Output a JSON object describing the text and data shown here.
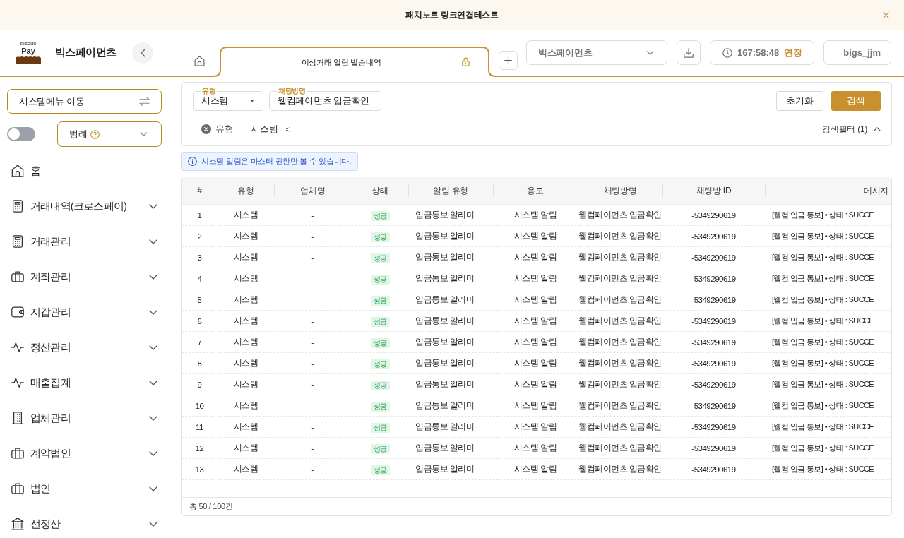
{
  "banner": {
    "text": "패치노트 링크연결테스트"
  },
  "sidebar": {
    "logo": {
      "tagline": "biscuit",
      "wordmark": "Pay"
    },
    "brand": "빅스페이먼츠",
    "menu_move": {
      "label": "시스템메뉴 이동"
    },
    "toggle": {
      "on": false
    },
    "legend": {
      "label": "범례"
    },
    "items": [
      {
        "label": "홈",
        "kind": "home",
        "expandable": false
      },
      {
        "label": "거래내역(크로스페이)",
        "kind": "calculator",
        "expandable": true,
        "expanded": false
      },
      {
        "label": "거래관리",
        "kind": "calculator",
        "expandable": true,
        "expanded": false
      },
      {
        "label": "계좌관리",
        "kind": "briefcase",
        "expandable": true,
        "expanded": false
      },
      {
        "label": "지갑관리",
        "kind": "wallet",
        "expandable": true,
        "expanded": false
      },
      {
        "label": "정산관리",
        "kind": "pulse",
        "expandable": true,
        "expanded": false
      },
      {
        "label": "매출집계",
        "kind": "pulse",
        "expandable": true,
        "expanded": false
      },
      {
        "label": "업체관리",
        "kind": "building",
        "expandable": true,
        "expanded": false
      },
      {
        "label": "계약법인",
        "kind": "briefcase",
        "expandable": true,
        "expanded": false
      },
      {
        "label": "법인",
        "kind": "briefcase",
        "expandable": true,
        "expanded": false
      },
      {
        "label": "선정산",
        "kind": "bank",
        "expandable": true,
        "expanded": false
      }
    ]
  },
  "tabs": [
    {
      "label": "이상거래 알림 발송내역",
      "selected": true,
      "locked": true
    }
  ],
  "header": {
    "company": "빅스페이먼츠",
    "timer": "167:58:48",
    "extend": "연장",
    "user": "bigs_jjm"
  },
  "filters": {
    "fields": [
      {
        "kind": "select",
        "label": "유형",
        "value": "시스템"
      },
      {
        "kind": "input",
        "label": "채팅방명",
        "value": "웰컴페이먼츠 입금확인"
      }
    ],
    "buttons": [
      {
        "label": "초기화",
        "kind": "secondary"
      },
      {
        "label": "검색",
        "kind": "primary"
      }
    ],
    "active": [
      {
        "label": "유형",
        "values": [
          "시스템"
        ]
      }
    ],
    "toggle": {
      "label": "검색필터 (1)",
      "expanded": true
    }
  },
  "notice": {
    "text": "시스템 알림은 마스터 권한만 볼 수 있습니다."
  },
  "table": {
    "columns": [
      {
        "label": "#",
        "kind": "text"
      },
      {
        "label": "유형",
        "kind": "text"
      },
      {
        "label": "업체명",
        "kind": "text"
      },
      {
        "label": "상태",
        "kind": "badge"
      },
      {
        "label": "알림 유형",
        "kind": "text"
      },
      {
        "label": "용도",
        "kind": "text"
      },
      {
        "label": "채팅방명",
        "kind": "text"
      },
      {
        "label": "채팅방 ID",
        "kind": "text"
      },
      {
        "label": "메시지",
        "kind": "text"
      }
    ],
    "rows": [
      {
        "cells": [
          "1",
          "시스템",
          "-",
          "성공",
          "입금통보 알리미",
          "시스템 알림",
          "웰컴페이먼츠 입금확인",
          "-5349290619",
          "[웰컴 입금 통보] • 상태 : SUCCE"
        ]
      },
      {
        "cells": [
          "2",
          "시스템",
          "-",
          "성공",
          "입금통보 알리미",
          "시스템 알림",
          "웰컴페이먼츠 입금확인",
          "-5349290619",
          "[웰컴 입금 통보] • 상태 : SUCCE"
        ]
      },
      {
        "cells": [
          "3",
          "시스템",
          "-",
          "성공",
          "입금통보 알리미",
          "시스템 알림",
          "웰컴페이먼츠 입금확인",
          "-5349290619",
          "[웰컴 입금 통보] • 상태 : SUCCE"
        ]
      },
      {
        "cells": [
          "4",
          "시스템",
          "-",
          "성공",
          "입금통보 알리미",
          "시스템 알림",
          "웰컴페이먼츠 입금확인",
          "-5349290619",
          "[웰컴 입금 통보] • 상태 : SUCCE"
        ]
      },
      {
        "cells": [
          "5",
          "시스템",
          "-",
          "성공",
          "입금통보 알리미",
          "시스템 알림",
          "웰컴페이먼츠 입금확인",
          "-5349290619",
          "[웰컴 입금 통보] • 상태 : SUCCE"
        ]
      },
      {
        "cells": [
          "6",
          "시스템",
          "-",
          "성공",
          "입금통보 알리미",
          "시스템 알림",
          "웰컴페이먼츠 입금확인",
          "-5349290619",
          "[웰컴 입금 통보] • 상태 : SUCCE"
        ]
      },
      {
        "cells": [
          "7",
          "시스템",
          "-",
          "성공",
          "입금통보 알리미",
          "시스템 알림",
          "웰컴페이먼츠 입금확인",
          "-5349290619",
          "[웰컴 입금 통보] • 상태 : SUCCE"
        ]
      },
      {
        "cells": [
          "8",
          "시스템",
          "-",
          "성공",
          "입금통보 알리미",
          "시스템 알림",
          "웰컴페이먼츠 입금확인",
          "-5349290619",
          "[웰컴 입금 통보] • 상태 : SUCCE"
        ]
      },
      {
        "cells": [
          "9",
          "시스템",
          "-",
          "성공",
          "입금통보 알리미",
          "시스템 알림",
          "웰컴페이먼츠 입금확인",
          "-5349290619",
          "[웰컴 입금 통보] • 상태 : SUCCE"
        ]
      },
      {
        "cells": [
          "10",
          "시스템",
          "-",
          "성공",
          "입금통보 알리미",
          "시스템 알림",
          "웰컴페이먼츠 입금확인",
          "-5349290619",
          "[웰컴 입금 통보] • 상태 : SUCCE"
        ]
      },
      {
        "cells": [
          "11",
          "시스템",
          "-",
          "성공",
          "입금통보 알리미",
          "시스템 알림",
          "웰컴페이먼츠 입금확인",
          "-5349290619",
          "[웰컴 입금 통보] • 상태 : SUCCE"
        ]
      },
      {
        "cells": [
          "12",
          "시스템",
          "-",
          "성공",
          "입금통보 알리미",
          "시스템 알림",
          "웰컴페이먼츠 입금확인",
          "-5349290619",
          "[웰컴 입금 통보] • 상태 : SUCCE"
        ]
      },
      {
        "cells": [
          "13",
          "시스템",
          "-",
          "성공",
          "입금통보 알리미",
          "시스템 알림",
          "웰컴페이먼츠 입금확인",
          "-5349290619",
          "[웰컴 입금 통보] • 상태 : SUCCE"
        ]
      }
    ],
    "footer": "총 50 / 100건"
  }
}
